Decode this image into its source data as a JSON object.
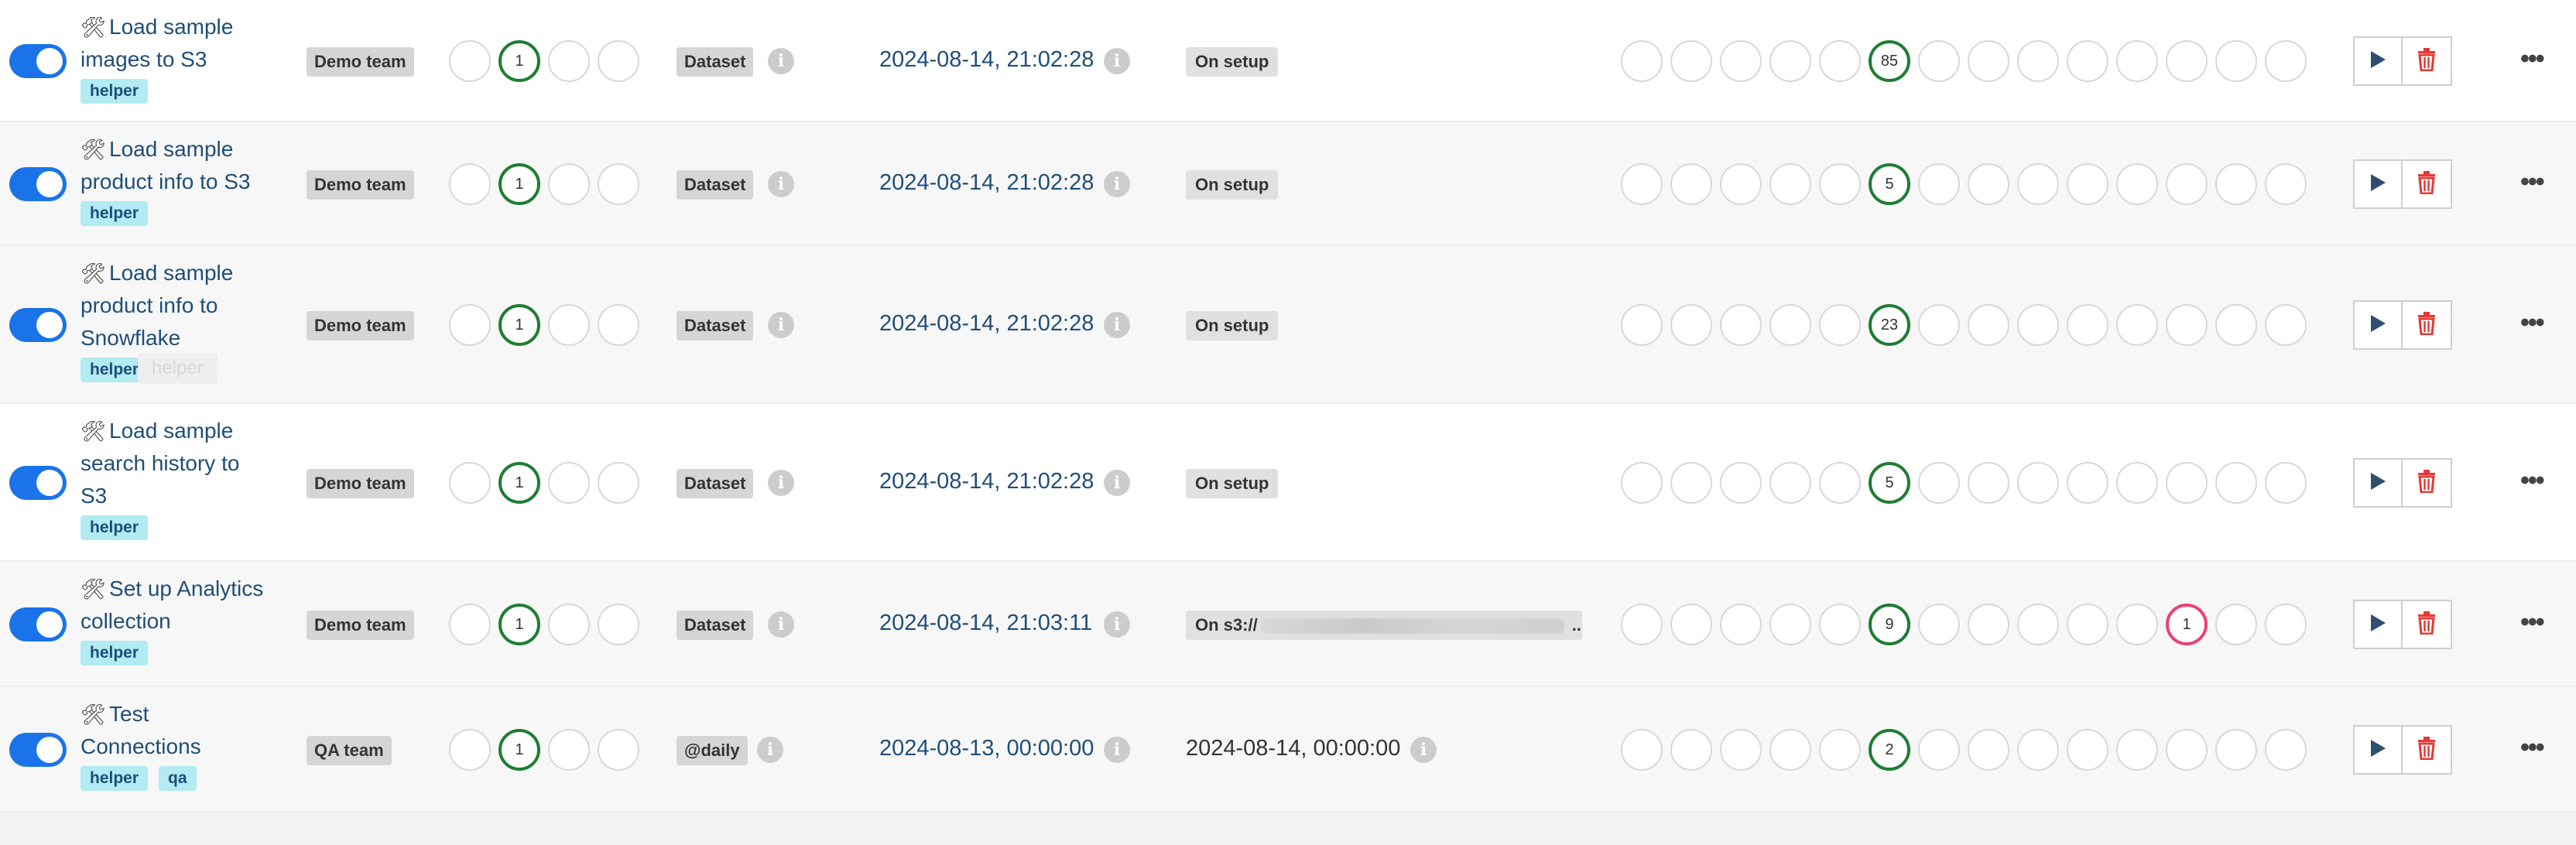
{
  "rows": [
    {
      "id": "r1",
      "title_lines": [
        "Load sample",
        "images to S3"
      ],
      "tags": [
        "helper"
      ],
      "owner": "Demo team",
      "schedule": "Dataset",
      "last_run": "2024-08-14, 21:02:28",
      "next_run": {
        "type": "badge",
        "text": "On setup"
      },
      "run_history": [
        null,
        "1",
        null,
        null
      ],
      "task_states": [
        null,
        null,
        null,
        null,
        null,
        "85",
        null,
        null,
        null,
        null,
        null,
        null,
        null,
        null
      ],
      "failed_index": null,
      "bg": "white"
    },
    {
      "id": "r2",
      "title_lines": [
        "Load sample",
        "product info to S3"
      ],
      "tags": [
        "helper"
      ],
      "owner": "Demo team",
      "schedule": "Dataset",
      "last_run": "2024-08-14, 21:02:28",
      "next_run": {
        "type": "badge",
        "text": "On setup"
      },
      "run_history": [
        null,
        "1",
        null,
        null
      ],
      "task_states": [
        null,
        null,
        null,
        null,
        null,
        "5",
        null,
        null,
        null,
        null,
        null,
        null,
        null,
        null
      ],
      "failed_index": null,
      "bg": "grey"
    },
    {
      "id": "r3",
      "title_lines": [
        "Load sample",
        "product info to",
        "Snowflake"
      ],
      "tags": [
        "helper"
      ],
      "ghost_tag": "helper",
      "owner": "Demo team",
      "schedule": "Dataset",
      "last_run": "2024-08-14, 21:02:28",
      "next_run": {
        "type": "badge",
        "text": "On setup"
      },
      "run_history": [
        null,
        "1",
        null,
        null
      ],
      "task_states": [
        null,
        null,
        null,
        null,
        null,
        "23",
        null,
        null,
        null,
        null,
        null,
        null,
        null,
        null
      ],
      "failed_index": null,
      "bg": "grey"
    },
    {
      "id": "r4",
      "title_lines": [
        "Load sample",
        "search history to",
        "S3"
      ],
      "tags": [
        "helper"
      ],
      "owner": "Demo team",
      "schedule": "Dataset",
      "last_run": "2024-08-14, 21:02:28",
      "next_run": {
        "type": "badge",
        "text": "On setup"
      },
      "run_history": [
        null,
        "1",
        null,
        null
      ],
      "task_states": [
        null,
        null,
        null,
        null,
        null,
        "5",
        null,
        null,
        null,
        null,
        null,
        null,
        null,
        null
      ],
      "failed_index": null,
      "bg": "white"
    },
    {
      "id": "r5",
      "title_lines": [
        "Set up Analytics",
        "collection"
      ],
      "tags": [
        "helper"
      ],
      "owner": "Demo team",
      "schedule": "Dataset",
      "last_run": "2024-08-14, 21:03:11",
      "next_run": {
        "type": "badge_wide",
        "text": "On s3://",
        "suffix": "..."
      },
      "run_history": [
        null,
        "1",
        null,
        null
      ],
      "task_states": [
        null,
        null,
        null,
        null,
        null,
        "9",
        null,
        null,
        null,
        null,
        null,
        "1",
        null,
        null
      ],
      "failed_index": 11,
      "bg": "grey"
    },
    {
      "id": "r6",
      "title_lines": [
        "Test",
        "Connections"
      ],
      "tags": [
        "helper",
        "qa"
      ],
      "owner": "QA team",
      "schedule": "@daily",
      "last_run": "2024-08-13, 00:00:00",
      "next_run": {
        "type": "text",
        "text": "2024-08-14, 00:00:00"
      },
      "run_history": [
        null,
        "1",
        null,
        null
      ],
      "task_states": [
        null,
        null,
        null,
        null,
        null,
        "2",
        null,
        null,
        null,
        null,
        null,
        null,
        null,
        null
      ],
      "failed_index": null,
      "bg": "grey"
    }
  ],
  "icons": {
    "tool": "hammer-wrench-icon",
    "info": "info-icon",
    "play": "play-icon",
    "delete": "trash-icon",
    "more": "more-horizontal-icon"
  },
  "labels": {
    "info_glyph": "i",
    "more_glyph": "•••",
    "tool_glyph": "🛠"
  },
  "colors": {
    "toggle_on": "#1a73e8",
    "success": "#1e7d32",
    "failed": "#ec407a",
    "tag_bg": "#b2ebf2",
    "delete": "#e53935",
    "play": "#2f4f6f"
  }
}
